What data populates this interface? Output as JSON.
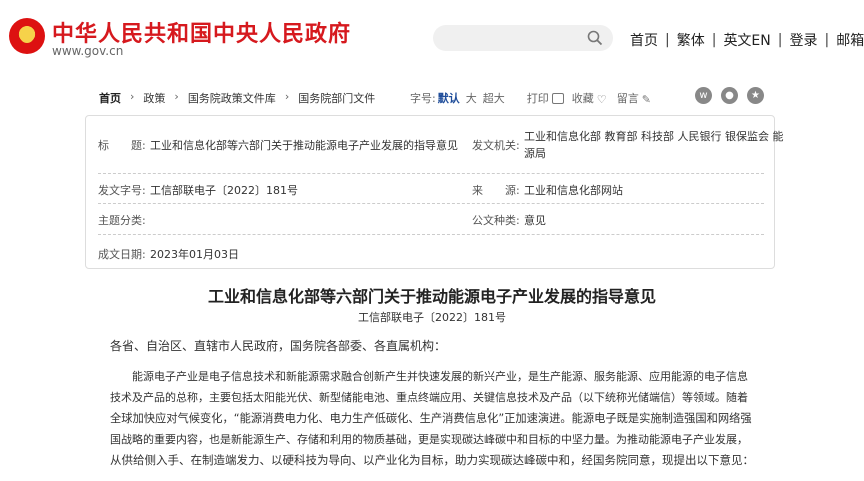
{
  "header": {
    "site_title": "中华人民共和国中央人民政府",
    "site_url": "www.gov.cn",
    "search_placeholder": "",
    "nav": [
      "首页",
      "繁体",
      "英文EN",
      "登录",
      "邮箱"
    ]
  },
  "breadcrumb": [
    "首页",
    "政策",
    "国务院政策文件库",
    "国务院部门文件"
  ],
  "tools": {
    "font_label": "字号:",
    "font_default": "默认",
    "font_large": "大",
    "font_xlarge": "超大",
    "print": "打印",
    "favorite": "收藏",
    "comment": "留言"
  },
  "info": {
    "title_label": "标　　题:",
    "title_value": "工业和信息化部等六部门关于推动能源电子产业发展的指导意见",
    "issuer_label": "发文机关:",
    "issuer_line1": "工业和信息化部 教育部 科技部 人民银行 银保监会 能",
    "issuer_line2": "源局",
    "docno_label": "发文字号:",
    "docno_value": "工信部联电子〔2022〕181号",
    "source_label": "来　　源:",
    "source_value": "工业和信息化部网站",
    "topic_label": "主题分类:",
    "topic_value": "",
    "type_label": "公文种类:",
    "type_value": "意见",
    "date_label": "成文日期:",
    "date_value": "2023年01月03日"
  },
  "article": {
    "title": "工业和信息化部等六部门关于推动能源电子产业发展的指导意见",
    "doc_no": "工信部联电子〔2022〕181号",
    "salutation": "各省、自治区、直辖市人民政府，国务院各部委、各直属机构：",
    "body_lines": [
      "　　能源电子产业是电子信息技术和新能源需求融合创新产生并快速发展的新兴产业，是生产能源、服务能源、应用能源的电子信息",
      "技术及产品的总称，主要包括太阳能光伏、新型储能电池、重点终端应用、关键信息技术及产品（以下统称光储端信）等领域。随着",
      "全球加快应对气候变化，“能源消费电力化、电力生产低碳化、生产消费信息化”正加速演进。能源电子既是实施制造强国和网络强",
      "国战略的重要内容，也是新能源生产、存储和利用的物质基础，更是实现碳达峰碳中和目标的中坚力量。为推动能源电子产业发展，",
      "从供给侧入手、在制造端发力、以硬科技为导向、以产业化为目标，助力实现碳达峰碳中和，经国务院同意，现提出以下意见："
    ]
  }
}
